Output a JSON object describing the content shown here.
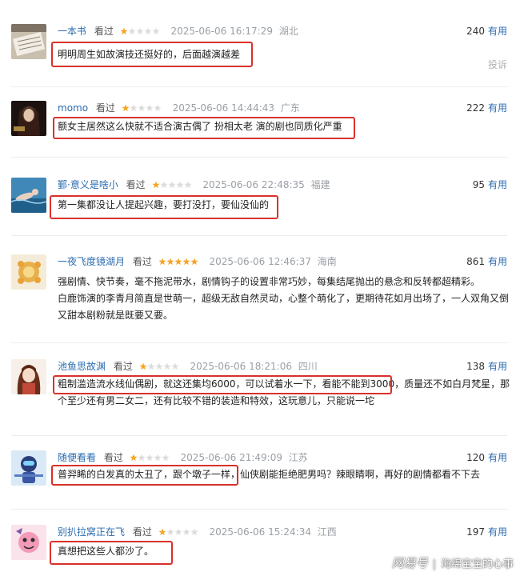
{
  "vote_label": "有用",
  "report_label": "投诉",
  "watermark": {
    "logo": "网易号",
    "separator": "|",
    "author": "海绵宝宝的心事"
  },
  "reviews": [
    {
      "user": "一本书",
      "status": "看过",
      "rating": 1,
      "time": "2025-06-06 16:17:29",
      "location": "湖北",
      "votes": "240",
      "content": "明明周生如故演技还挺好的，后面越演越差",
      "avatar": "book-avatar"
    },
    {
      "user": "momo",
      "status": "看过",
      "rating": 1,
      "time": "2025-06-06 14:44:43",
      "location": "广东",
      "votes": "222",
      "content": "额女主居然这么快就不适合演古偶了 扮相太老 演的剧也同质化严重",
      "avatar": "poster-avatar"
    },
    {
      "user": "鄞·意义是啥小",
      "status": "看过",
      "rating": 1,
      "time": "2025-06-06 22:48:35",
      "location": "福建",
      "votes": "95",
      "content": "第一集都没让人提起兴趣，要打没打，要仙没仙的",
      "avatar": "water-avatar"
    },
    {
      "user": "一夜飞度镜湖月",
      "status": "看过",
      "rating": 5,
      "time": "2025-06-06 12:46:37",
      "location": "海南",
      "votes": "861",
      "content_lines": [
        "强剧情、快节奏，毫不拖泥带水，剧情钩子的设置非常巧妙，每集结尾抛出的悬念和反转都超精彩。",
        "白鹿饰演的李青月简直是世萌一，超级无敌自然灵动，心整个萌化了，更期待花如月出场了，一人双角又倒",
        "又甜本剧粉就是既要又要。"
      ],
      "avatar": "flower-avatar"
    },
    {
      "user": "池鱼思故渊",
      "status": "看过",
      "rating": 1,
      "time": "2025-06-06 18:21:06",
      "location": "四川",
      "votes": "138",
      "content_lines": [
        "粗制滥造流水线仙偶剧，就这还集均6000，可以试着水一下，看能不能到3000，质量还不如白月梵星，那",
        "个至少还有男二女二，还有比较不错的装造和特效，这玩意儿，只能说一坨"
      ],
      "avatar": "anime-avatar"
    },
    {
      "user": "随便看看",
      "status": "看过",
      "rating": 1,
      "time": "2025-06-06 21:49:09",
      "location": "江苏",
      "votes": "120",
      "content": "普羿睎的白发真的太丑了，跟个墩子一样，仙侠剧能拒绝肥男吗？辣眼睛啊，再好的剧情都看不下去",
      "avatar": "robot-avatar"
    },
    {
      "user": "别扒拉窝正在飞",
      "status": "看过",
      "rating": 1,
      "time": "2025-06-06 15:24:34",
      "location": "江西",
      "votes": "197",
      "content": "真想把这些人都沙了。",
      "avatar": "cartoon-avatar"
    }
  ]
}
